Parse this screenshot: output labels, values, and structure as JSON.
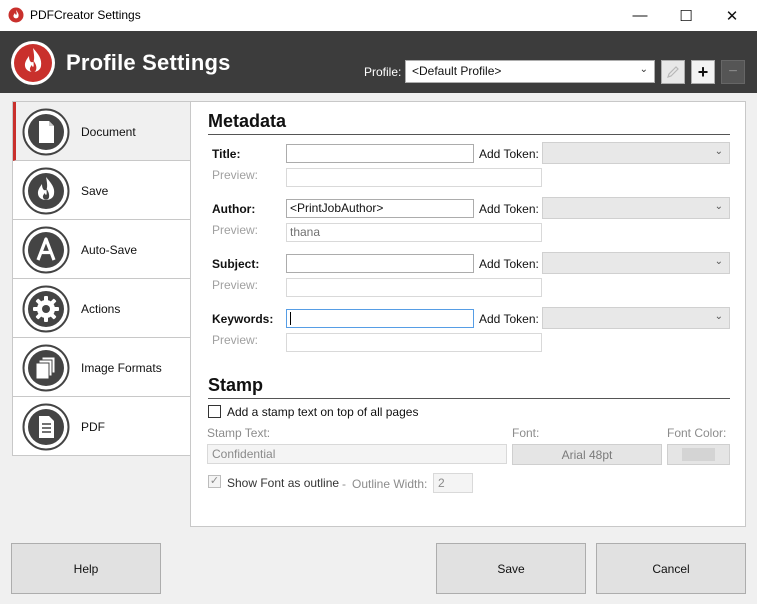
{
  "window": {
    "title": "PDFCreator Settings",
    "minimize_glyph": "—",
    "maximize_glyph": "☐",
    "close_glyph": "✕"
  },
  "header": {
    "title": "Profile Settings",
    "profile_label": "Profile:",
    "profile_value": "<Default Profile>"
  },
  "sidebar": {
    "items": [
      {
        "label": "Document",
        "icon": "document-icon",
        "active": true
      },
      {
        "label": "Save",
        "icon": "flame-icon",
        "active": false
      },
      {
        "label": "Auto-Save",
        "icon": "letter-a-icon",
        "active": false
      },
      {
        "label": "Actions",
        "icon": "gear-icon",
        "active": false
      },
      {
        "label": "Image Formats",
        "icon": "image-formats-icon",
        "active": false
      },
      {
        "label": "PDF",
        "icon": "pdf-document-icon",
        "active": false
      }
    ]
  },
  "metadata": {
    "section_title": "Metadata",
    "add_token_label": "Add Token:",
    "preview_label": "Preview:",
    "fields": [
      {
        "label": "Title:",
        "value": "",
        "preview": ""
      },
      {
        "label": "Author:",
        "value": "<PrintJobAuthor>",
        "preview": "thana"
      },
      {
        "label": "Subject:",
        "value": "",
        "preview": ""
      },
      {
        "label": "Keywords:",
        "value": "",
        "preview": ""
      }
    ]
  },
  "stamp": {
    "section_title": "Stamp",
    "enable_label": "Add a stamp text on top of all pages",
    "enabled": false,
    "stamp_text_label": "Stamp Text:",
    "stamp_text_value": "Confidential",
    "font_label": "Font:",
    "font_value": "Arial 48pt",
    "font_color_label": "Font Color:",
    "outline_label": "Show Font as outline",
    "outline_checked": true,
    "separator": "-",
    "outline_width_label": "Outline Width:",
    "outline_width_value": "2"
  },
  "footer": {
    "help_label": "Help",
    "save_label": "Save",
    "cancel_label": "Cancel"
  },
  "colors": {
    "header_bg": "#3c3c3c",
    "accent_red": "#c9302c",
    "font_color_swatch": "#d4d4d4"
  }
}
